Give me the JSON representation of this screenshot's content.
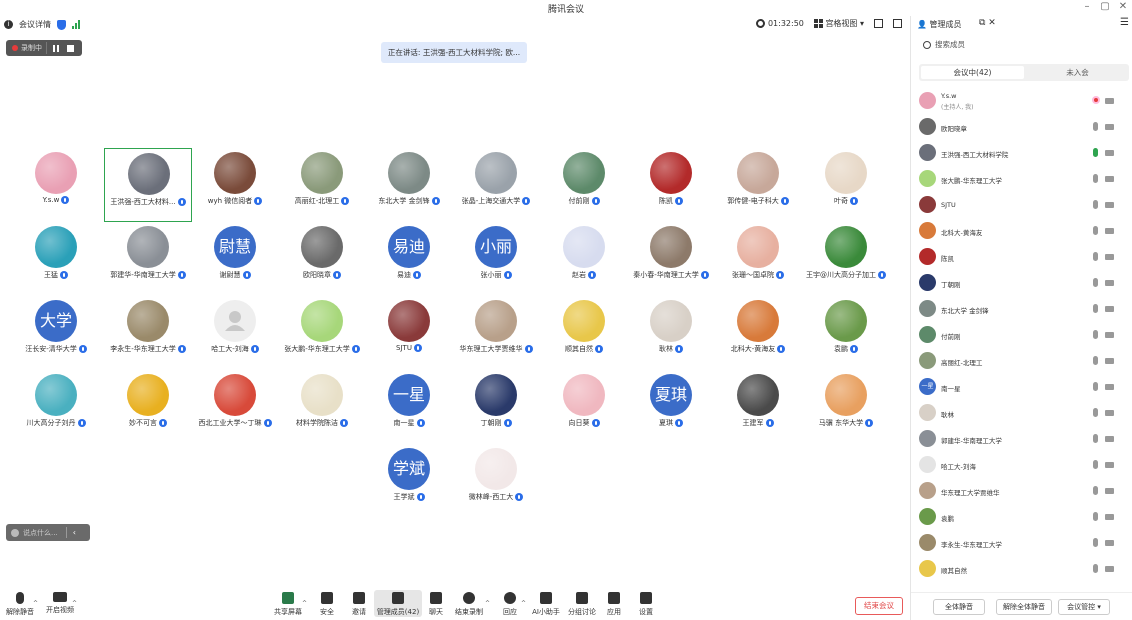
{
  "window": {
    "title": "腾讯会议",
    "controls": [
      "–",
      "▢",
      "✕"
    ]
  },
  "infobar": {
    "details_label": "会议详情",
    "timer": "01:32:50",
    "view_label": "宫格视图 ▾"
  },
  "recording": {
    "label": "录制中"
  },
  "speaking": {
    "text": "正在讲话: 王洪强-西工大材料学院; 欧..."
  },
  "participants_grid": [
    {
      "name": "Y.s.w",
      "avatar": "photo",
      "color": "#e9a0b4",
      "col": 0,
      "row": 0
    },
    {
      "name": "王洪强-西工大材料...",
      "avatar": "photo",
      "color": "#6b6f7a",
      "col": 1,
      "row": 0,
      "active": true
    },
    {
      "name": "wyh 微信阅者",
      "avatar": "photo",
      "color": "#7a4b3a",
      "col": 2,
      "row": 0
    },
    {
      "name": "高丽红-北理工",
      "avatar": "photo",
      "color": "#8a9a7a",
      "col": 3,
      "row": 0
    },
    {
      "name": "东北大学 金剑锋",
      "avatar": "photo",
      "color": "#7d8a86",
      "col": 4,
      "row": 0
    },
    {
      "name": "张晶-上海交通大学",
      "avatar": "photo",
      "color": "#9aa2aa",
      "col": 5,
      "row": 0
    },
    {
      "name": "付前刚",
      "avatar": "photo",
      "color": "#5d8a6a",
      "col": 6,
      "row": 0
    },
    {
      "name": "陈凯",
      "avatar": "photo",
      "color": "#b32a2a",
      "col": 7,
      "row": 0
    },
    {
      "name": "郭传健-电子科大",
      "avatar": "photo",
      "color": "#c7a89a",
      "col": 8,
      "row": 0
    },
    {
      "name": "叶奇",
      "avatar": "photo",
      "color": "#e7d8c7",
      "col": 9,
      "row": 0
    },
    {
      "name": "王猛",
      "avatar": "photo",
      "color": "#2aa0b8",
      "col": 0,
      "row": 1
    },
    {
      "name": "郭建华-华南理工大学",
      "avatar": "photo",
      "color": "#8a8f96",
      "col": 1,
      "row": 1
    },
    {
      "name": "谢尉慧",
      "avatar": "text",
      "label": "尉慧",
      "col": 2,
      "row": 1
    },
    {
      "name": "欧阳晓章",
      "avatar": "photo",
      "color": "#6a6a6a",
      "col": 3,
      "row": 1
    },
    {
      "name": "易迪",
      "avatar": "text",
      "label": "易迪",
      "col": 4,
      "row": 1
    },
    {
      "name": "张小丽",
      "avatar": "text",
      "label": "小丽",
      "col": 5,
      "row": 1
    },
    {
      "name": "赵岩",
      "avatar": "photo",
      "color": "#d7dcef",
      "col": 6,
      "row": 1
    },
    {
      "name": "秦小春-华南理工大学",
      "avatar": "photo",
      "color": "#8d7a6a",
      "col": 7,
      "row": 1
    },
    {
      "name": "张珊～国卓院",
      "avatar": "photo",
      "color": "#e7b0a0",
      "col": 8,
      "row": 1
    },
    {
      "name": "王宇@川大高分子加工",
      "avatar": "photo",
      "color": "#3a8a3a",
      "col": 9,
      "row": 1
    },
    {
      "name": "汪长安-清华大学",
      "avatar": "text",
      "label": "大学",
      "col": 0,
      "row": 2
    },
    {
      "name": "李永生-华东理工大学",
      "avatar": "photo",
      "color": "#9a8a6a",
      "col": 1,
      "row": 2
    },
    {
      "name": "哈工大-刘海",
      "avatar": "placeholder",
      "col": 2,
      "row": 2
    },
    {
      "name": "张大鹏-华东理工大学",
      "avatar": "photo",
      "color": "#a7d77a",
      "col": 3,
      "row": 2
    },
    {
      "name": "SJTU",
      "avatar": "photo",
      "color": "#8a3a3a",
      "col": 4,
      "row": 2
    },
    {
      "name": "华东理工大学贾维华",
      "avatar": "photo",
      "color": "#b8a08a",
      "col": 5,
      "row": 2
    },
    {
      "name": "顺其自然",
      "avatar": "photo",
      "color": "#e8c74a",
      "col": 6,
      "row": 2
    },
    {
      "name": "耿林",
      "avatar": "photo",
      "color": "#d8d0c7",
      "col": 7,
      "row": 2
    },
    {
      "name": "北科大-黄海友",
      "avatar": "photo",
      "color": "#d87a3a",
      "col": 8,
      "row": 2
    },
    {
      "name": "袁鹏",
      "avatar": "photo",
      "color": "#6a9a4a",
      "col": 9,
      "row": 2
    },
    {
      "name": "川大高分子刘丹",
      "avatar": "photo",
      "color": "#4ab0c0",
      "col": 0,
      "row": 3
    },
    {
      "name": "妙不可言",
      "avatar": "photo",
      "color": "#e8b020",
      "col": 1,
      "row": 3
    },
    {
      "name": "西北工业大学～丁琳",
      "avatar": "photo",
      "color": "#d84a3a",
      "col": 2,
      "row": 3
    },
    {
      "name": "材料学院陈洁",
      "avatar": "photo",
      "color": "#e8e0c8",
      "col": 3,
      "row": 3
    },
    {
      "name": "南一星",
      "avatar": "text",
      "label": "一星",
      "col": 4,
      "row": 3
    },
    {
      "name": "丁朝刚",
      "avatar": "photo",
      "color": "#2a3a6a",
      "col": 5,
      "row": 3
    },
    {
      "name": "向日葵",
      "avatar": "photo",
      "color": "#f0b8c0",
      "col": 6,
      "row": 3
    },
    {
      "name": "夏琪",
      "avatar": "text",
      "label": "夏琪",
      "col": 7,
      "row": 3
    },
    {
      "name": "王建军",
      "avatar": "photo",
      "color": "#4a4a4a",
      "col": 8,
      "row": 3
    },
    {
      "name": "马骥 东华大学",
      "avatar": "photo",
      "color": "#e8a060",
      "col": 9,
      "row": 3
    },
    {
      "name": "王学斌",
      "avatar": "text",
      "label": "学斌",
      "col": 4,
      "row": 4
    },
    {
      "name": "微林峰-西工大",
      "avatar": "photo",
      "color": "#f2e8e8",
      "col": 5,
      "row": 4
    }
  ],
  "chat": {
    "placeholder": "说点什么..."
  },
  "toolbar": {
    "left": [
      {
        "label": "解除静音"
      },
      {
        "label": "开启视频"
      }
    ],
    "center": [
      {
        "label": "共享屏幕"
      },
      {
        "label": "安全"
      },
      {
        "label": "邀请"
      },
      {
        "label": "管理成员(42)"
      },
      {
        "label": "聊天"
      },
      {
        "label": "结束录制"
      },
      {
        "label": "回应"
      },
      {
        "label": "AI小助手"
      },
      {
        "label": "分组讨论"
      },
      {
        "label": "应用"
      },
      {
        "label": "设置"
      }
    ],
    "end_label": "结束会议"
  },
  "panel": {
    "title": "管理成员",
    "search_placeholder": "搜索成员",
    "tabs": [
      "会议中(42)",
      "未入会"
    ],
    "members": [
      {
        "name": "Y.s.w",
        "sub": "(主持人, 我)",
        "color": "#e9a0b4",
        "mic": "rec"
      },
      {
        "name": "欧阳晓章",
        "color": "#6a6a6a"
      },
      {
        "name": "王洪强-西工大材料学院",
        "color": "#6b6f7a",
        "mic": "on"
      },
      {
        "name": "张大鹏-华东理工大学",
        "color": "#a7d77a"
      },
      {
        "name": "SJTU",
        "color": "#8a3a3a"
      },
      {
        "name": "北科大-黄海友",
        "color": "#d87a3a"
      },
      {
        "name": "陈凯",
        "color": "#b32a2a"
      },
      {
        "name": "丁朝刚",
        "color": "#2a3a6a"
      },
      {
        "name": "东北大学 金剑锋",
        "color": "#7d8a86"
      },
      {
        "name": "付前刚",
        "color": "#5d8a6a"
      },
      {
        "name": "高丽红-北理工",
        "color": "#8a9a7a"
      },
      {
        "name": "南一星",
        "text": "一星"
      },
      {
        "name": "耿林",
        "color": "#d8d0c7"
      },
      {
        "name": "郭建华-华南理工大学",
        "color": "#8a8f96"
      },
      {
        "name": "哈工大-刘海",
        "color": "#e4e4e4"
      },
      {
        "name": "华东理工大学贾维华",
        "color": "#b8a08a"
      },
      {
        "name": "袁鹏",
        "color": "#6a9a4a"
      },
      {
        "name": "李永生-华东理工大学",
        "color": "#9a8a6a"
      },
      {
        "name": "顺其自然",
        "color": "#e8c74a"
      }
    ],
    "buttons": [
      "全体静音",
      "解除全体静音",
      "会议管控 ▾"
    ]
  },
  "colors": {
    "accent": "#2a6de8",
    "active_border": "#2ea44f",
    "end": "#e04545",
    "text_avatar": "#3b6cc8"
  }
}
